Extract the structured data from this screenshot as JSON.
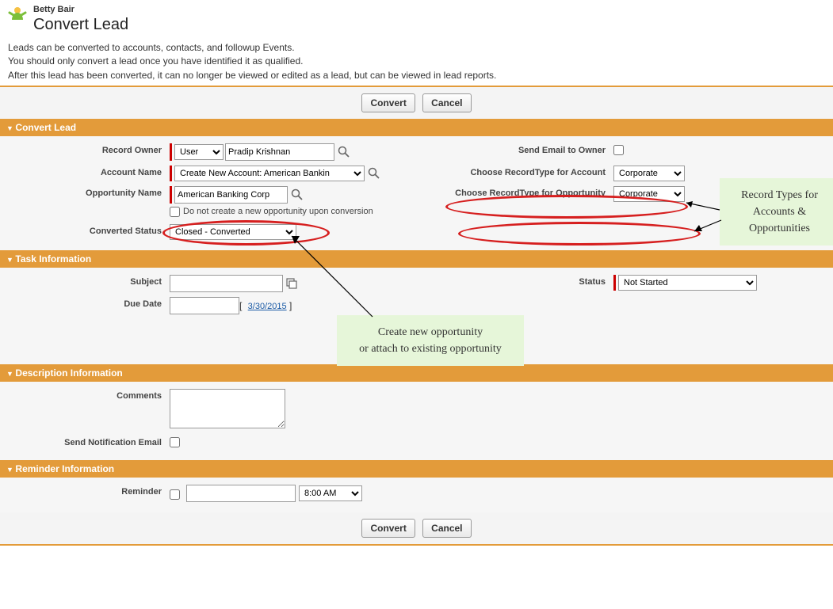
{
  "header": {
    "lead_name": "Betty Bair",
    "title": "Convert Lead",
    "intro1": "Leads can be converted to accounts, contacts, and followup Events.",
    "intro2": "You should only convert a lead once you have identified it as qualified.",
    "intro3": "After this lead has been converted, it can no longer be viewed or edited as a lead, but can be viewed in lead reports."
  },
  "buttons": {
    "convert": "Convert",
    "cancel": "Cancel"
  },
  "sections": {
    "convert_lead": "Convert Lead",
    "task_info": "Task Information",
    "desc_info": "Description Information",
    "reminder_info": "Reminder Information"
  },
  "convert": {
    "record_owner_label": "Record Owner",
    "owner_type": "User",
    "owner_name": "Pradip Krishnan",
    "send_email_label": "Send Email to Owner",
    "send_email_checked": false,
    "account_name_label": "Account Name",
    "account_name_value": "Create New Account: American Bankin",
    "rt_account_label": "Choose RecordType for Account",
    "rt_account_value": "Corporate",
    "opp_name_label": "Opportunity Name",
    "opp_name_value": "American Banking Corp",
    "opp_nocreate_label": "Do not create a new opportunity upon conversion",
    "opp_nocreate_checked": false,
    "rt_opp_label": "Choose RecordType for Opportunity",
    "rt_opp_value": "Corporate",
    "status_label": "Converted Status",
    "status_value": "Closed - Converted"
  },
  "task": {
    "subject_label": "Subject",
    "subject_value": "",
    "status_label": "Status",
    "status_value": "Not Started",
    "due_date_label": "Due Date",
    "due_date_value": "",
    "date_hint": "3/30/2015"
  },
  "desc": {
    "comments_label": "Comments",
    "comments_value": "",
    "notify_label": "Send Notification Email",
    "notify_checked": false
  },
  "reminder": {
    "label": "Reminder",
    "checked": false,
    "date_value": "",
    "time_value": "8:00 AM"
  },
  "annotations": {
    "rt_note": "Record Types for Accounts & Opportunities",
    "opp_note_l1": "Create new opportunity",
    "opp_note_l2": "or attach to existing  opportunity"
  }
}
